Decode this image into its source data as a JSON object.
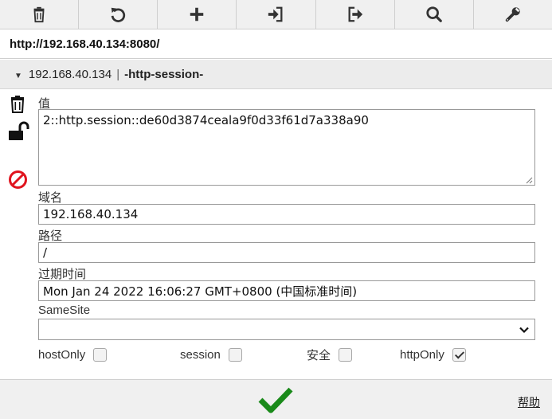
{
  "toolbar": {
    "buttons": [
      {
        "icon": "trash-icon",
        "name": "delete-all-button"
      },
      {
        "icon": "reset-icon",
        "name": "reset-button"
      },
      {
        "icon": "plus-icon",
        "name": "add-cookie-button"
      },
      {
        "icon": "import-icon",
        "name": "import-button"
      },
      {
        "icon": "export-icon",
        "name": "export-button"
      },
      {
        "icon": "search-icon",
        "name": "search-button"
      },
      {
        "icon": "wrench-icon",
        "name": "settings-button"
      }
    ]
  },
  "url": "http://192.168.40.134:8080/",
  "cookie": {
    "domain_header": "192.168.40.134",
    "separator": "|",
    "name_header": "-http-session-"
  },
  "fields": {
    "value_label": "值",
    "value": "2::http.session::de60d3874ceala9f0d33f61d7a338a90",
    "domain_label": "域名",
    "domain": "192.168.40.134",
    "path_label": "路径",
    "path": "/",
    "expiry_label": "过期时间",
    "expiry": "Mon Jan 24 2022 16:06:27 GMT+0800 (中国标准时间)",
    "samesite_label": "SameSite",
    "samesite": ""
  },
  "flags": {
    "hostonly_label": "hostOnly",
    "hostonly": false,
    "session_label": "session",
    "session": false,
    "secure_label": "安全",
    "secure": false,
    "httponly_label": "httpOnly",
    "httponly": true
  },
  "footer": {
    "help_label": "帮助"
  },
  "colors": {
    "toolbar_bg": "#f0f0f0",
    "header_bg": "#ececec",
    "save_green": "#1a8a1a",
    "block_red": "#e0141e"
  }
}
